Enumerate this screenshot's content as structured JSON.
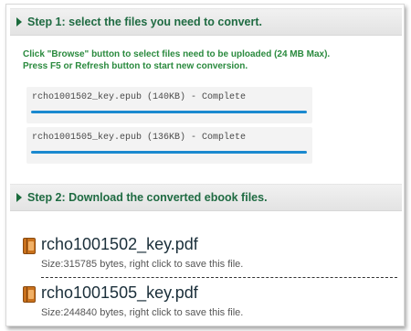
{
  "step1": {
    "title": "Step 1: select the files you need to convert.",
    "instructions": [
      "Click \"Browse\" button to select files need to be uploaded (24 MB Max).",
      "Press F5 or Refresh button to start new conversion."
    ],
    "uploads": [
      {
        "label": "rcho1001502_key.epub (140KB) - Complete",
        "progress": 1.0
      },
      {
        "label": "rcho1001505_key.epub (136KB) - Complete",
        "progress": 1.0
      }
    ]
  },
  "step2": {
    "title": "Step 2: Download the converted ebook files.",
    "files": [
      {
        "name": "rcho1001502_key.pdf",
        "meta": "Size:315785 bytes, right click to save this file.",
        "icon": "book-icon"
      },
      {
        "name": "rcho1001505_key.pdf",
        "meta": "Size:244840 bytes, right click to save this file.",
        "icon": "book-icon"
      }
    ]
  },
  "colors": {
    "header_text": "#1f6b42",
    "instruction_text": "#2a8a3e",
    "progress_bar": "#1a89cf",
    "file_icon": "#c9711c"
  }
}
